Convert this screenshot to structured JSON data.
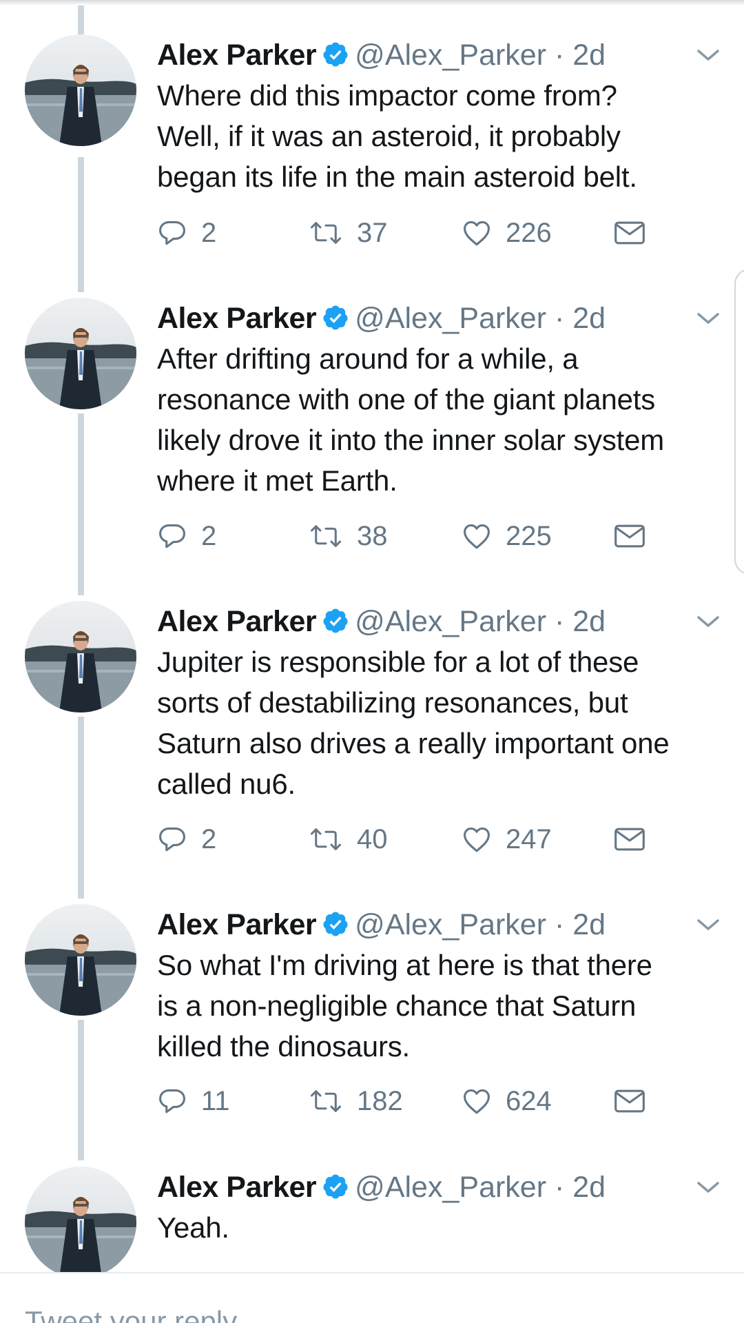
{
  "composer": {
    "placeholder": "Tweet your reply"
  },
  "colors": {
    "accent": "#1da1f2",
    "muted": "#657786",
    "thread_line": "#ccd6dd"
  },
  "tweets": [
    {
      "name": "Alex Parker",
      "handle": "@Alex_Parker",
      "time": "2d",
      "lines": [
        "Where did this impactor come from?",
        "Well, if it was an asteroid, it probably",
        "began its life in the main asteroid belt."
      ],
      "replies": "2",
      "retweets": "37",
      "likes": "226"
    },
    {
      "name": "Alex Parker",
      "handle": "@Alex_Parker",
      "time": "2d",
      "lines": [
        "After drifting around for a while, a",
        "resonance with one of the giant planets",
        "likely drove it into the inner solar system",
        "where it met Earth."
      ],
      "replies": "2",
      "retweets": "38",
      "likes": "225"
    },
    {
      "name": "Alex Parker",
      "handle": "@Alex_Parker",
      "time": "2d",
      "lines": [
        "Jupiter is responsible for a lot of these",
        "sorts of destabilizing resonances, but",
        "Saturn also drives a really important one",
        "called nu6."
      ],
      "replies": "2",
      "retweets": "40",
      "likes": "247"
    },
    {
      "name": "Alex Parker",
      "handle": "@Alex_Parker",
      "time": "2d",
      "lines": [
        "So what I'm driving at here is that there",
        "is a non-negligible chance that Saturn",
        "killed the dinosaurs."
      ],
      "replies": "11",
      "retweets": "182",
      "likes": "624"
    },
    {
      "name": "Alex Parker",
      "handle": "@Alex_Parker",
      "time": "2d",
      "lines": [
        "Yeah."
      ]
    }
  ],
  "icons": {
    "verified": "verified-badge-icon",
    "caret": "chevron-down-icon",
    "reply": "reply-icon",
    "retweet": "retweet-icon",
    "like": "heart-icon",
    "dm": "envelope-icon"
  }
}
